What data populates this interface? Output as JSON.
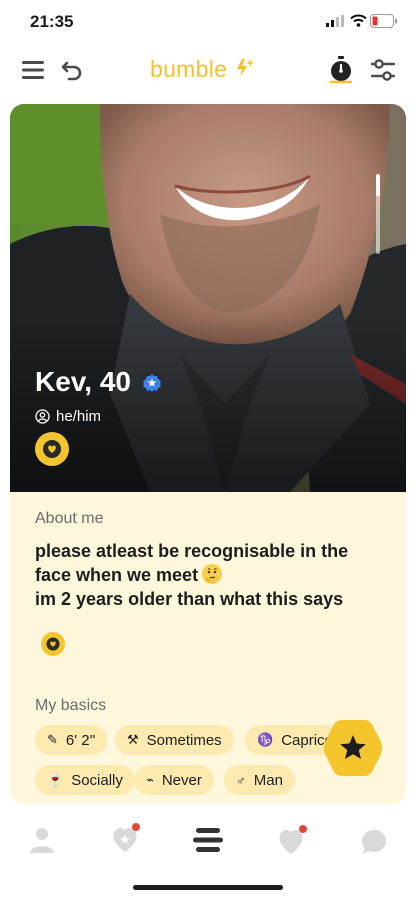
{
  "status_bar": {
    "time": "21:35"
  },
  "header": {
    "logo_text": "bumble",
    "brand_color": "#f5c029"
  },
  "profile": {
    "name_age": "Kev, 40",
    "pronouns": "he/him",
    "about_title": "About me",
    "about_lines": [
      "please atleast be recognisable in the",
      "face when we meet",
      "im 2 years older than what this says"
    ],
    "basics_title": "My basics",
    "basics": [
      {
        "icon": "ruler-icon",
        "label": "6' 2''"
      },
      {
        "icon": "dumbbell-icon",
        "label": "Sometimes"
      },
      {
        "icon": "zodiac-icon",
        "label": "Capricorn"
      },
      {
        "icon": "wine-glass-icon",
        "label": "Socially"
      },
      {
        "icon": "smoking-icon",
        "label": "Never"
      },
      {
        "icon": "gender-icon",
        "label": "Man"
      }
    ]
  },
  "nav": [
    "profile-tab",
    "discover-tab",
    "people-tab",
    "liked-you-tab",
    "chats-tab"
  ]
}
